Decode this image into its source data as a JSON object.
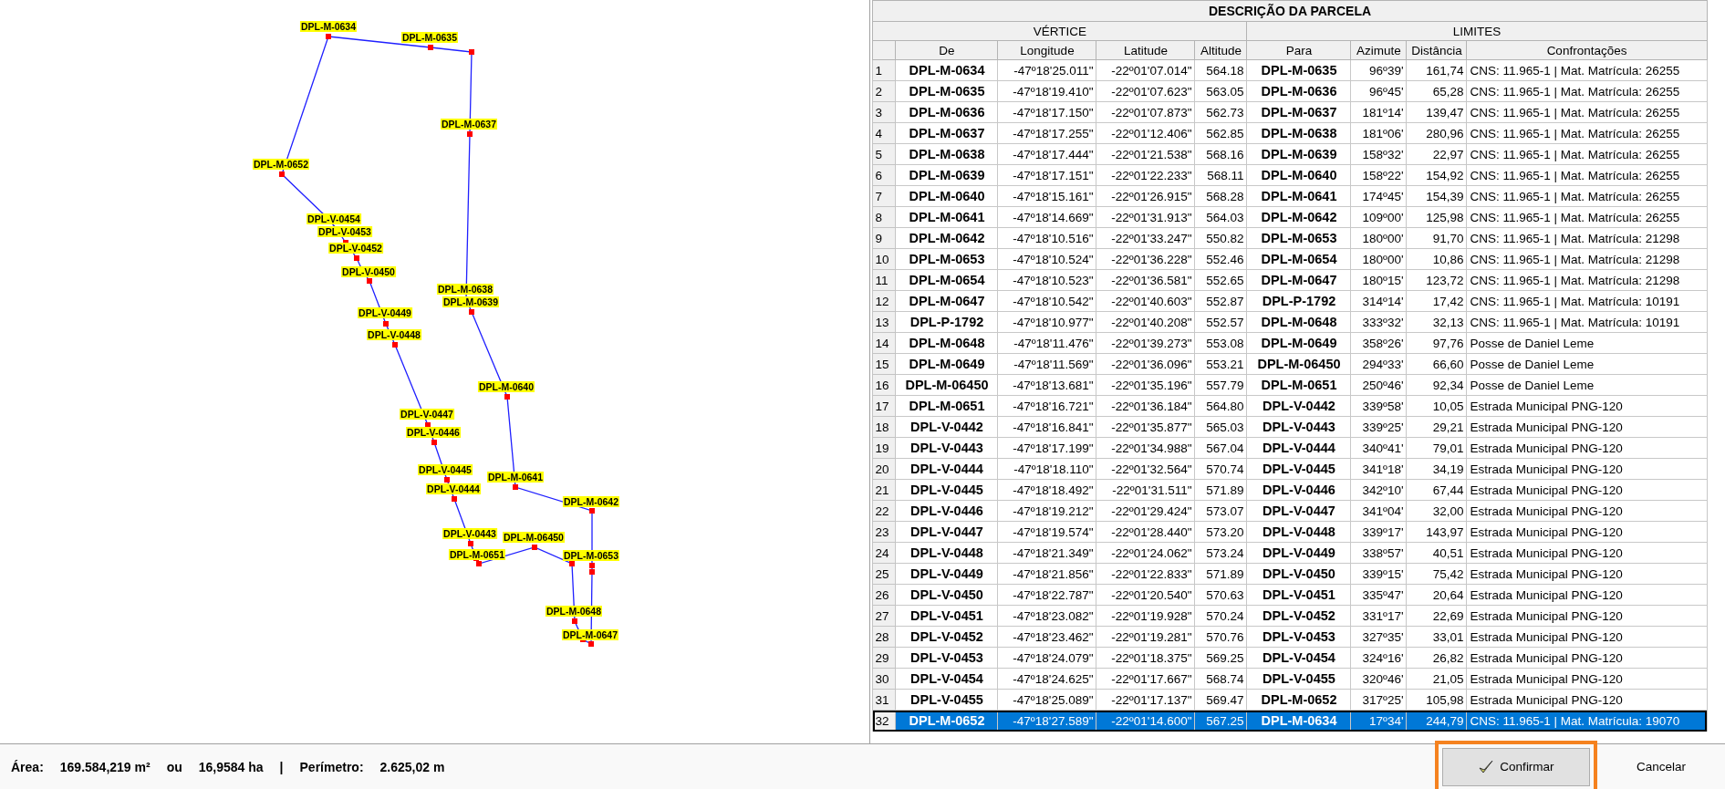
{
  "map": {
    "labels": [
      "DPL-M-0634",
      "DPL-M-0635",
      "DPL-M-0637",
      "DPL-M-0652",
      "DPL-V-0454",
      "DPL-V-0453",
      "DPL-V-0452",
      "DPL-V-0450",
      "DPL-M-0638",
      "DPL-M-0639",
      "DPL-V-0449",
      "DPL-V-0448",
      "DPL-M-0640",
      "DPL-V-0447",
      "DPL-V-0446",
      "DPL-V-0445",
      "DPL-M-0641",
      "DPL-V-0444",
      "DPL-M-0642",
      "DPL-V-0443",
      "DPL-M-06450",
      "DPL-M-0651",
      "DPL-M-0653",
      "DPL-M-0648",
      "DPL-M-0647"
    ]
  },
  "table": {
    "title": "DESCRIÇÃO DA PARCELA",
    "groups": [
      "VÉRTICE",
      "LIMITES"
    ],
    "columns": [
      "De",
      "Longitude",
      "Latitude",
      "Altitude",
      "Para",
      "Azimute",
      "Distância",
      "Confrontações"
    ],
    "rows": [
      {
        "n": "1",
        "cells": [
          "DPL-M-0634",
          "-47º18'25.011\"",
          "-22º01'07.014\"",
          "564.18",
          "DPL-M-0635",
          "96º39'",
          "161,74",
          "CNS: 11.965-1 | Mat. Matrícula: 26255"
        ],
        "selected": false
      },
      {
        "n": "2",
        "cells": [
          "DPL-M-0635",
          "-47º18'19.410\"",
          "-22º01'07.623\"",
          "563.05",
          "DPL-M-0636",
          "96º45'",
          "65,28",
          "CNS: 11.965-1 | Mat. Matrícula: 26255"
        ],
        "selected": false
      },
      {
        "n": "3",
        "cells": [
          "DPL-M-0636",
          "-47º18'17.150\"",
          "-22º01'07.873\"",
          "562.73",
          "DPL-M-0637",
          "181º14'",
          "139,47",
          "CNS: 11.965-1 | Mat. Matrícula: 26255"
        ],
        "selected": false
      },
      {
        "n": "4",
        "cells": [
          "DPL-M-0637",
          "-47º18'17.255\"",
          "-22º01'12.406\"",
          "562.85",
          "DPL-M-0638",
          "181º06'",
          "280,96",
          "CNS: 11.965-1 | Mat. Matrícula: 26255"
        ],
        "selected": false
      },
      {
        "n": "5",
        "cells": [
          "DPL-M-0638",
          "-47º18'17.444\"",
          "-22º01'21.538\"",
          "568.16",
          "DPL-M-0639",
          "158º32'",
          "22,97",
          "CNS: 11.965-1 | Mat. Matrícula: 26255"
        ],
        "selected": false
      },
      {
        "n": "6",
        "cells": [
          "DPL-M-0639",
          "-47º18'17.151\"",
          "-22º01'22.233\"",
          "568.11",
          "DPL-M-0640",
          "158º22'",
          "154,92",
          "CNS: 11.965-1 | Mat. Matrícula: 26255"
        ],
        "selected": false
      },
      {
        "n": "7",
        "cells": [
          "DPL-M-0640",
          "-47º18'15.161\"",
          "-22º01'26.915\"",
          "568.28",
          "DPL-M-0641",
          "174º45'",
          "154,39",
          "CNS: 11.965-1 | Mat. Matrícula: 26255"
        ],
        "selected": false
      },
      {
        "n": "8",
        "cells": [
          "DPL-M-0641",
          "-47º18'14.669\"",
          "-22º01'31.913\"",
          "564.03",
          "DPL-M-0642",
          "109º00'",
          "125,98",
          "CNS: 11.965-1 | Mat. Matrícula: 26255"
        ],
        "selected": false
      },
      {
        "n": "9",
        "cells": [
          "DPL-M-0642",
          "-47º18'10.516\"",
          "-22º01'33.247\"",
          "550.82",
          "DPL-M-0653",
          "180º00'",
          "91,70",
          "CNS: 11.965-1 | Mat. Matrícula: 21298"
        ],
        "selected": false
      },
      {
        "n": "10",
        "cells": [
          "DPL-M-0653",
          "-47º18'10.524\"",
          "-22º01'36.228\"",
          "552.46",
          "DPL-M-0654",
          "180º00'",
          "10,86",
          "CNS: 11.965-1 | Mat. Matrícula: 21298"
        ],
        "selected": false
      },
      {
        "n": "11",
        "cells": [
          "DPL-M-0654",
          "-47º18'10.523\"",
          "-22º01'36.581\"",
          "552.65",
          "DPL-M-0647",
          "180º15'",
          "123,72",
          "CNS: 11.965-1 | Mat. Matrícula: 21298"
        ],
        "selected": false
      },
      {
        "n": "12",
        "cells": [
          "DPL-M-0647",
          "-47º18'10.542\"",
          "-22º01'40.603\"",
          "552.87",
          "DPL-P-1792",
          "314º14'",
          "17,42",
          "CNS: 11.965-1 | Mat. Matrícula: 10191"
        ],
        "selected": false
      },
      {
        "n": "13",
        "cells": [
          "DPL-P-1792",
          "-47º18'10.977\"",
          "-22º01'40.208\"",
          "552.57",
          "DPL-M-0648",
          "333º32'",
          "32,13",
          "CNS: 11.965-1 | Mat. Matrícula: 10191"
        ],
        "selected": false
      },
      {
        "n": "14",
        "cells": [
          "DPL-M-0648",
          "-47º18'11.476\"",
          "-22º01'39.273\"",
          "553.08",
          "DPL-M-0649",
          "358º26'",
          "97,76",
          "Posse de Daniel Leme"
        ],
        "selected": false
      },
      {
        "n": "15",
        "cells": [
          "DPL-M-0649",
          "-47º18'11.569\"",
          "-22º01'36.096\"",
          "553.21",
          "DPL-M-06450",
          "294º33'",
          "66,60",
          "Posse de Daniel Leme"
        ],
        "selected": false
      },
      {
        "n": "16",
        "cells": [
          "DPL-M-06450",
          "-47º18'13.681\"",
          "-22º01'35.196\"",
          "557.79",
          "DPL-M-0651",
          "250º46'",
          "92,34",
          "Posse de Daniel Leme"
        ],
        "selected": false
      },
      {
        "n": "17",
        "cells": [
          "DPL-M-0651",
          "-47º18'16.721\"",
          "-22º01'36.184\"",
          "564.80",
          "DPL-V-0442",
          "339º58'",
          "10,05",
          "Estrada Municipal PNG-120"
        ],
        "selected": false
      },
      {
        "n": "18",
        "cells": [
          "DPL-V-0442",
          "-47º18'16.841\"",
          "-22º01'35.877\"",
          "565.03",
          "DPL-V-0443",
          "339º25'",
          "29,21",
          "Estrada Municipal PNG-120"
        ],
        "selected": false
      },
      {
        "n": "19",
        "cells": [
          "DPL-V-0443",
          "-47º18'17.199\"",
          "-22º01'34.988\"",
          "567.04",
          "DPL-V-0444",
          "340º41'",
          "79,01",
          "Estrada Municipal PNG-120"
        ],
        "selected": false
      },
      {
        "n": "20",
        "cells": [
          "DPL-V-0444",
          "-47º18'18.110\"",
          "-22º01'32.564\"",
          "570.74",
          "DPL-V-0445",
          "341º18'",
          "34,19",
          "Estrada Municipal PNG-120"
        ],
        "selected": false
      },
      {
        "n": "21",
        "cells": [
          "DPL-V-0445",
          "-47º18'18.492\"",
          "-22º01'31.511\"",
          "571.89",
          "DPL-V-0446",
          "342º10'",
          "67,44",
          "Estrada Municipal PNG-120"
        ],
        "selected": false
      },
      {
        "n": "22",
        "cells": [
          "DPL-V-0446",
          "-47º18'19.212\"",
          "-22º01'29.424\"",
          "573.07",
          "DPL-V-0447",
          "341º04'",
          "32,00",
          "Estrada Municipal PNG-120"
        ],
        "selected": false
      },
      {
        "n": "23",
        "cells": [
          "DPL-V-0447",
          "-47º18'19.574\"",
          "-22º01'28.440\"",
          "573.20",
          "DPL-V-0448",
          "339º17'",
          "143,97",
          "Estrada Municipal PNG-120"
        ],
        "selected": false
      },
      {
        "n": "24",
        "cells": [
          "DPL-V-0448",
          "-47º18'21.349\"",
          "-22º01'24.062\"",
          "573.24",
          "DPL-V-0449",
          "338º57'",
          "40,51",
          "Estrada Municipal PNG-120"
        ],
        "selected": false
      },
      {
        "n": "25",
        "cells": [
          "DPL-V-0449",
          "-47º18'21.856\"",
          "-22º01'22.833\"",
          "571.89",
          "DPL-V-0450",
          "339º15'",
          "75,42",
          "Estrada Municipal PNG-120"
        ],
        "selected": false
      },
      {
        "n": "26",
        "cells": [
          "DPL-V-0450",
          "-47º18'22.787\"",
          "-22º01'20.540\"",
          "570.63",
          "DPL-V-0451",
          "335º47'",
          "20,64",
          "Estrada Municipal PNG-120"
        ],
        "selected": false
      },
      {
        "n": "27",
        "cells": [
          "DPL-V-0451",
          "-47º18'23.082\"",
          "-22º01'19.928\"",
          "570.24",
          "DPL-V-0452",
          "331º17'",
          "22,69",
          "Estrada Municipal PNG-120"
        ],
        "selected": false
      },
      {
        "n": "28",
        "cells": [
          "DPL-V-0452",
          "-47º18'23.462\"",
          "-22º01'19.281\"",
          "570.76",
          "DPL-V-0453",
          "327º35'",
          "33,01",
          "Estrada Municipal PNG-120"
        ],
        "selected": false
      },
      {
        "n": "29",
        "cells": [
          "DPL-V-0453",
          "-47º18'24.079\"",
          "-22º01'18.375\"",
          "569.25",
          "DPL-V-0454",
          "324º16'",
          "26,82",
          "Estrada Municipal PNG-120"
        ],
        "selected": false
      },
      {
        "n": "30",
        "cells": [
          "DPL-V-0454",
          "-47º18'24.625\"",
          "-22º01'17.667\"",
          "568.74",
          "DPL-V-0455",
          "320º46'",
          "21,05",
          "Estrada Municipal PNG-120"
        ],
        "selected": false
      },
      {
        "n": "31",
        "cells": [
          "DPL-V-0455",
          "-47º18'25.089\"",
          "-22º01'17.137\"",
          "569.47",
          "DPL-M-0652",
          "317º25'",
          "105,98",
          "Estrada Municipal PNG-120"
        ],
        "selected": false
      },
      {
        "n": "32",
        "cells": [
          "DPL-M-0652",
          "-47º18'27.589\"",
          "-22º01'14.600\"",
          "567.25",
          "DPL-M-0634",
          "17º34'",
          "244,79",
          "CNS: 11.965-1 | Mat. Matrícula: 19070"
        ],
        "selected": true
      }
    ]
  },
  "summary": [
    {
      "label": "Área:",
      "value": "169.584,219 m²"
    },
    {
      "label": "ou",
      "value": "16,9584 ha"
    },
    {
      "label": "|"
    },
    {
      "label": "Perímetro:",
      "value": "2.625,02 m"
    }
  ],
  "buttons": [
    {
      "label": "Confirmar",
      "kind": "confirm",
      "highlighted": true
    },
    {
      "label": "Cancelar",
      "kind": "cancel",
      "highlighted": false
    }
  ]
}
